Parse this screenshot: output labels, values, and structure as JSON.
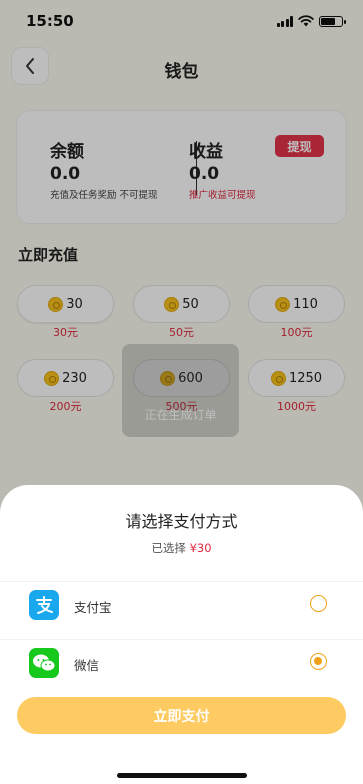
{
  "status_bar": {
    "time": "15:50"
  },
  "header": {
    "title": "钱包"
  },
  "wallet": {
    "balance_label": "余额",
    "balance_value": "0.0",
    "balance_note": "充值及任务奖励 不可提现",
    "earnings_label": "收益",
    "earnings_value": "0.0",
    "earnings_note": "推广收益可提现",
    "withdraw_label": "提现"
  },
  "recharge": {
    "section_title": "立即充值",
    "options": [
      {
        "coins": "30",
        "price": "30元"
      },
      {
        "coins": "50",
        "price": "50元"
      },
      {
        "coins": "110",
        "price": "100元"
      },
      {
        "coins": "230",
        "price": "200元"
      },
      {
        "coins": "600",
        "price": "500元"
      },
      {
        "coins": "1250",
        "price": "1000元"
      }
    ],
    "selected_index": 0
  },
  "toast": {
    "text": "正在生成订单"
  },
  "payment_sheet": {
    "title": "请选择支付方式",
    "selected_prefix": "已选择",
    "selected_amount": "¥30",
    "methods": [
      {
        "name": "支付宝",
        "icon": "alipay-icon",
        "selected": false
      },
      {
        "name": "微信",
        "icon": "wechat-icon",
        "selected": true
      }
    ],
    "pay_button": "立即支付"
  },
  "colors": {
    "accent_red": "#e5344a",
    "accent_orange": "#f0a11c",
    "pay_button": "#fdcb61",
    "alipay_blue": "#19a7ee",
    "wechat_green": "#17c81d"
  }
}
